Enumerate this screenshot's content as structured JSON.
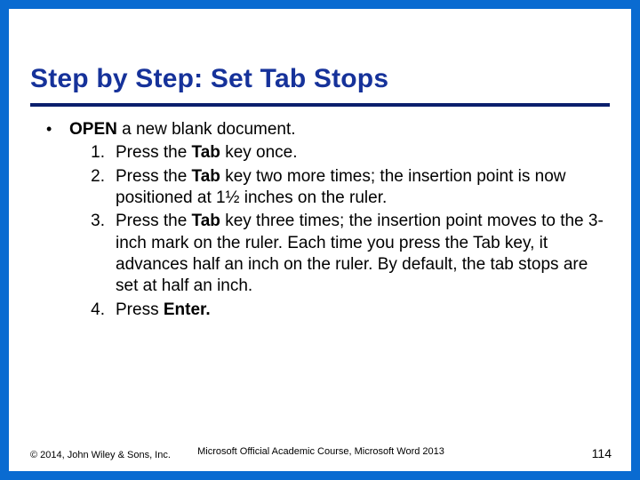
{
  "title": "Step by Step: Set Tab Stops",
  "lead": {
    "bold": "OPEN",
    "rest": " a new blank document."
  },
  "steps": [
    {
      "n": "1.",
      "pre": "Press the ",
      "bold": "Tab",
      "post": " key once."
    },
    {
      "n": "2.",
      "pre": "Press the ",
      "bold": "Tab",
      "post": " key two more times; the insertion point is now positioned at 1½ inches on the ruler."
    },
    {
      "n": "3.",
      "pre": "Press the ",
      "bold": "Tab",
      "post": " key three times; the insertion point moves to the 3-inch mark on the ruler. Each time you press the Tab key, it advances half an inch on the ruler. By default, the tab stops are set at half an inch."
    },
    {
      "n": "4.",
      "pre": "Press ",
      "bold": "Enter.",
      "post": ""
    }
  ],
  "footer": {
    "left": "© 2014, John Wiley & Sons, Inc.",
    "center": "Microsoft Official Academic Course, Microsoft Word 2013",
    "page": "114"
  }
}
